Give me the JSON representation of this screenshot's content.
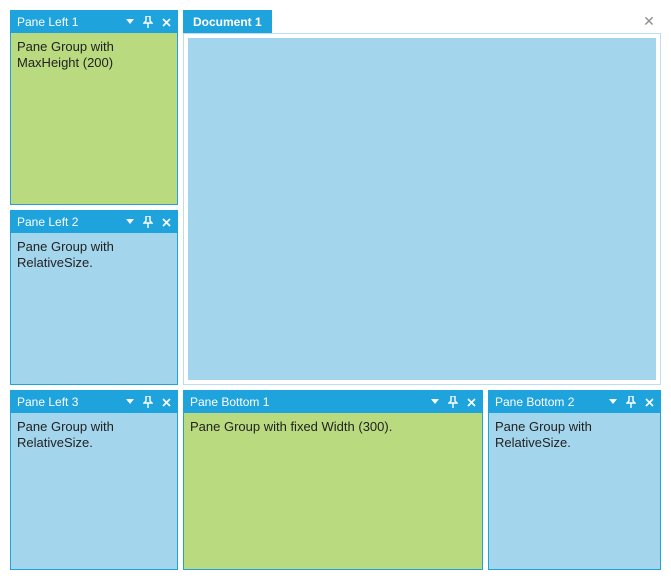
{
  "panes": {
    "left1": {
      "title": "Pane Left 1",
      "body": "Pane Group with MaxHeight (200)"
    },
    "left2": {
      "title": "Pane Left 2",
      "body": "Pane Group with RelativeSize."
    },
    "left3": {
      "title": "Pane Left 3",
      "body": "Pane Group with RelativeSize."
    },
    "bottom1": {
      "title": "Pane Bottom 1",
      "body": "Pane Group with fixed Width (300)."
    },
    "bottom2": {
      "title": "Pane Bottom 2",
      "body": "Pane Group with RelativeSize."
    }
  },
  "document": {
    "tab": "Document 1"
  },
  "glyph": {
    "close": "✕"
  },
  "colors": {
    "accent": "#1fa3dd",
    "panelGreen": "#b9da7f",
    "panelBlue": "#a3d5ed"
  }
}
